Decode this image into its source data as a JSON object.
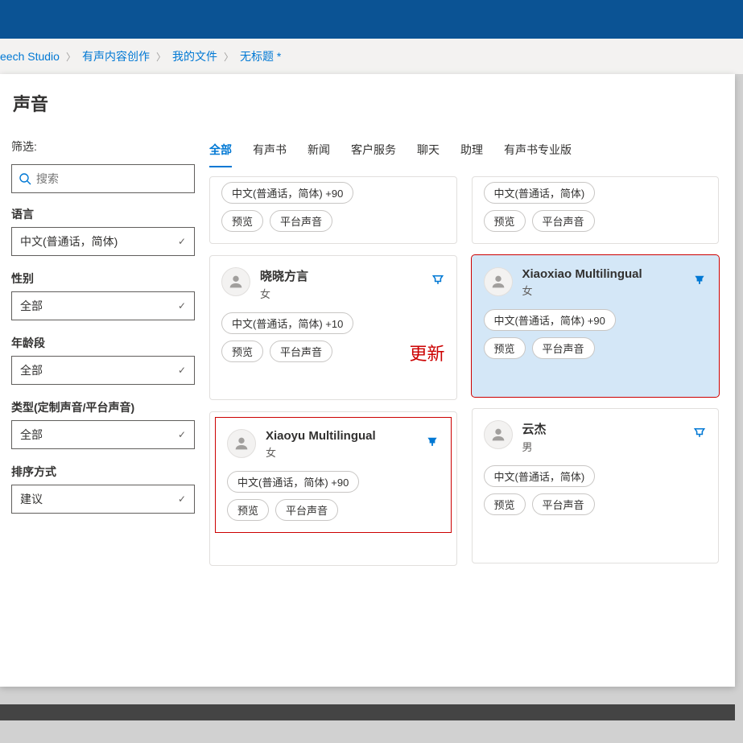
{
  "breadcrumb": {
    "items": [
      "eech Studio",
      "有声内容创作",
      "我的文件",
      "无标题 *"
    ]
  },
  "panel": {
    "title": "声音",
    "filter_label": "筛选:",
    "search_placeholder": "搜索"
  },
  "sidebar": {
    "language_label": "语言",
    "language_value": "中文(普通话，简体)",
    "gender_label": "性别",
    "gender_value": "全部",
    "age_label": "年龄段",
    "age_value": "全部",
    "type_label": "类型(定制声音/平台声音)",
    "type_value": "全部",
    "sort_label": "排序方式",
    "sort_value": "建议"
  },
  "tabs": {
    "items": [
      "全部",
      "有声书",
      "新闻",
      "客户服务",
      "聊天",
      "助理",
      "有声书专业版"
    ],
    "active": 0
  },
  "cards": {
    "partial_left": {
      "lang_chip": "中文(普通话，简体) +90",
      "preview": "预览",
      "platform": "平台声音"
    },
    "partial_right": {
      "lang_chip": "中文(普通话，简体)",
      "preview": "预览",
      "platform": "平台声音"
    },
    "xiaoxiao_dialect": {
      "name": "晓晓方言",
      "gender": "女",
      "lang_chip": "中文(普通话，简体) +10",
      "preview": "预览",
      "platform": "平台声音"
    },
    "xiaoxiao_multi": {
      "name": "Xiaoxiao Multilingual",
      "gender": "女",
      "lang_chip": "中文(普通话，简体) +90",
      "preview": "预览",
      "platform": "平台声音"
    },
    "xiaoyu_multi": {
      "name": "Xiaoyu Multilingual",
      "gender": "女",
      "lang_chip": "中文(普通话，简体) +90",
      "preview": "预览",
      "platform": "平台声音"
    },
    "yunjie": {
      "name": "云杰",
      "gender": "男",
      "lang_chip": "中文(普通话，简体)",
      "preview": "预览",
      "platform": "平台声音"
    }
  },
  "annotation": {
    "update": "更新"
  }
}
